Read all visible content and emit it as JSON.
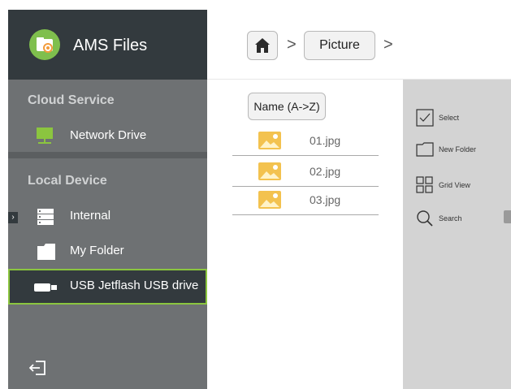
{
  "app": {
    "title": "AMS Files",
    "logo_icon": "folder-share-icon",
    "accent": "#8bc53f"
  },
  "sidebar": {
    "cloud_section": "Cloud Service",
    "local_section": "Local Device",
    "items": [
      {
        "label": "Network Drive",
        "icon": "network-drive-icon"
      },
      {
        "label": "Internal",
        "icon": "storage-icon"
      },
      {
        "label": "My Folder",
        "icon": "folder-icon"
      },
      {
        "label": "USB Jetflash USB drive",
        "icon": "usb-drive-icon",
        "selected": true
      }
    ],
    "expand_glyph": "›",
    "logout_icon": "logout-icon"
  },
  "breadcrumb": {
    "home_icon": "home-icon",
    "separator": ">",
    "current": "Picture"
  },
  "file_list": {
    "sort_label": "Name (A->Z)",
    "files": [
      {
        "name": "01.jpg",
        "icon": "image-icon"
      },
      {
        "name": "02.jpg",
        "icon": "image-icon"
      },
      {
        "name": "03.jpg",
        "icon": "image-icon"
      }
    ]
  },
  "actions": [
    {
      "label": "Select",
      "icon": "checkbox-icon"
    },
    {
      "label": "New Folder",
      "icon": "folder-outline-icon"
    },
    {
      "label": "Grid View",
      "icon": "grid-icon"
    },
    {
      "label": "Search",
      "icon": "search-icon"
    }
  ]
}
